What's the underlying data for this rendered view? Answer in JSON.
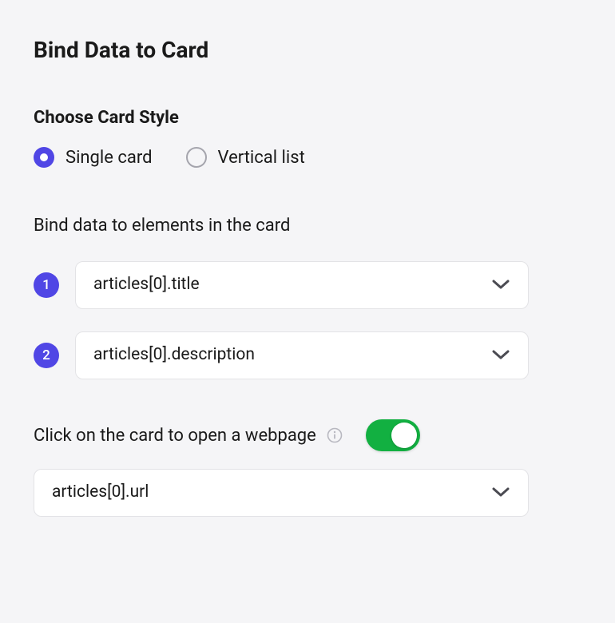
{
  "title": "Bind Data to Card",
  "cardStyle": {
    "heading": "Choose Card Style",
    "options": [
      {
        "label": "Single card",
        "selected": true
      },
      {
        "label": "Vertical list",
        "selected": false
      }
    ]
  },
  "bindSection": {
    "heading": "Bind data to elements in the card",
    "fields": [
      {
        "step": "1",
        "value": "articles[0].title"
      },
      {
        "step": "2",
        "value": "articles[0].description"
      }
    ]
  },
  "clickSection": {
    "label": "Click on the card to open a webpage",
    "enabled": true,
    "urlValue": "articles[0].url"
  }
}
